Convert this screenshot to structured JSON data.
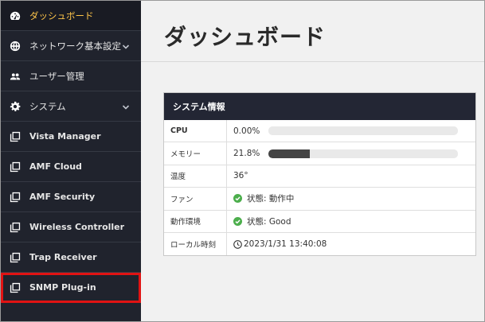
{
  "sidebar": {
    "items": [
      {
        "label": "ダッシュボード",
        "icon": "speedometer-icon",
        "active": true
      },
      {
        "label": "ネットワーク基本設定",
        "icon": "globe-icon",
        "expandable": true
      },
      {
        "label": "ユーザー管理",
        "icon": "users-icon"
      },
      {
        "label": "システム",
        "icon": "gear-icon",
        "expandable": true
      },
      {
        "label": "Vista Manager",
        "icon": "window-stack-icon"
      },
      {
        "label": "AMF Cloud",
        "icon": "window-stack-icon"
      },
      {
        "label": "AMF Security",
        "icon": "window-stack-icon"
      },
      {
        "label": "Wireless Controller",
        "icon": "window-stack-icon"
      },
      {
        "label": "Trap Receiver",
        "icon": "window-stack-icon"
      },
      {
        "label": "SNMP Plug-in",
        "icon": "window-stack-icon",
        "highlighted": true
      }
    ]
  },
  "main": {
    "title": "ダッシュボード",
    "system_info": {
      "header": "システム情報",
      "cpu_label": "CPU",
      "cpu_value": "0.00%",
      "cpu_fraction": 0.0,
      "memory_label": "メモリー",
      "memory_value": "21.8%",
      "memory_fraction": 0.218,
      "temp_label": "温度",
      "temp_value": "36°",
      "fan_label": "ファン",
      "fan_value": "状態: 動作中",
      "env_label": "動作環境",
      "env_value": "状態: Good",
      "time_label": "ローカル時刻",
      "time_value": "2023/1/31 13:40:08"
    }
  },
  "colors": {
    "sidebar_bg": "#20232d",
    "active_text": "#ffc64a",
    "highlight_border": "#e11313",
    "ok_green": "#4cae4c"
  }
}
